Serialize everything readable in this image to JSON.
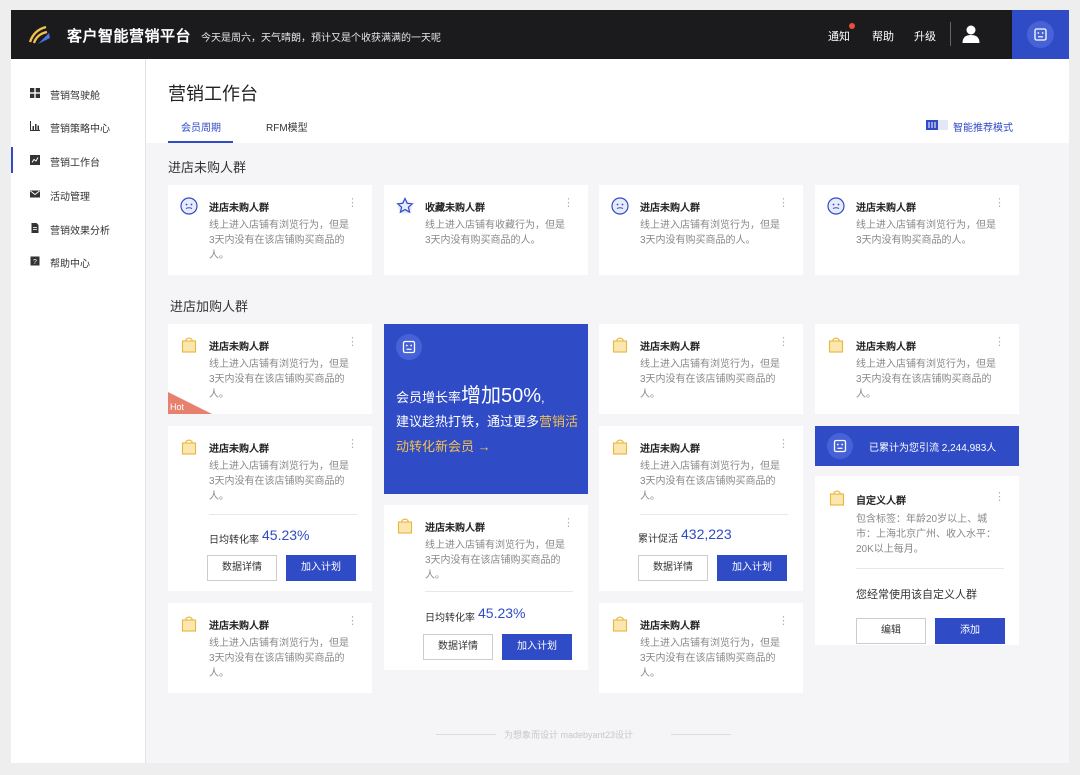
{
  "header": {
    "brand": "客户智能营销平台",
    "greeting": "今天是周六，天气晴朗，预计又是个收获满满的一天呢",
    "nav": {
      "notify": "通知",
      "help": "帮助",
      "upgrade": "升级"
    }
  },
  "sidebar": {
    "items": [
      {
        "label": "营销驾驶舱",
        "icon": "grid-icon"
      },
      {
        "label": "营销策略中心",
        "icon": "bar-chart-icon"
      },
      {
        "label": "营销工作台",
        "icon": "workbench-icon",
        "active": true
      },
      {
        "label": "活动管理",
        "icon": "mail-icon"
      },
      {
        "label": "营销效果分析",
        "icon": "document-icon"
      },
      {
        "label": "帮助中心",
        "icon": "help-icon"
      }
    ]
  },
  "page": {
    "title": "营销工作台",
    "tabs": [
      "会员周期",
      "RFM模型"
    ],
    "smart_mode": "智能推荐模式"
  },
  "section1": {
    "title": "进店未购人群",
    "cards": [
      {
        "title": "进店未购人群",
        "desc": "线上进入店铺有浏览行为，但是3天内没有在该店铺购买商品的人。"
      },
      {
        "title": "收藏未购人群",
        "desc": "线上进入店铺有收藏行为，但是3天内没有购买商品的人。"
      },
      {
        "title": "进店未购人群",
        "desc": "线上进入店铺有浏览行为，但是3天内没有购买商品的人。"
      },
      {
        "title": "进店未购人群",
        "desc": "线上进入店铺有浏览行为，但是3天内没有购买商品的人。"
      }
    ]
  },
  "section2": {
    "title": "进店加购人群",
    "card_a": {
      "title": "进店未购人群",
      "desc": "线上进入店铺有浏览行为，但是3天内没有在该店铺购买商品的人。",
      "badge": "Hot"
    },
    "card_b": {
      "title": "进店未购人群",
      "desc": "线上进入店铺有浏览行为，但是3天内没有在该店铺购买商品的人。",
      "stat_label": "日均转化率",
      "stat_value": "45.23%",
      "btn_detail": "数据详情",
      "btn_add": "加入计划"
    },
    "card_c": {
      "title": "进店未购人群",
      "desc": "线上进入店铺有浏览行为，但是3天内没有在该店铺购买商品的人。"
    },
    "promo": {
      "prefix": "会员增长率",
      "big": "增加50%",
      "suffix": ",",
      "line2a": "建议趁热打铁，通过更多",
      "line2b": "营销活动转化新会员 →"
    },
    "card_d": {
      "title": "进店未购人群",
      "desc": "线上进入店铺有浏览行为，但是3天内没有在该店铺购买商品的人。",
      "stat_label": "日均转化率",
      "stat_value": "45.23%",
      "btn_detail": "数据详情",
      "btn_add": "加入计划"
    },
    "card_e": {
      "title": "进店未购人群",
      "desc": "线上进入店铺有浏览行为，但是3天内没有在该店铺购买商品的人。"
    },
    "card_f": {
      "title": "进店未购人群",
      "desc": "线上进入店铺有浏览行为，但是3天内没有在该店铺购买商品的人。",
      "stat_label": "累计促活",
      "stat_value": "432,223",
      "btn_detail": "数据详情",
      "btn_add": "加入计划"
    },
    "card_g": {
      "title": "进店未购人群",
      "desc": "线上进入店铺有浏览行为，但是3天内没有在该店铺购买商品的人。"
    },
    "card_h": {
      "title": "进店未购人群",
      "desc": "线上进入店铺有浏览行为，但是3天内没有在该店铺购买商品的人。"
    },
    "traffic": "已累计为您引流 2,244,983人",
    "custom": {
      "title": "自定义人群",
      "desc": "包含标签：年龄20岁以上、城市：上海北京广州、收入水平：20K以上每月。",
      "note": "您经常使用该自定义人群",
      "btn_edit": "编辑",
      "btn_add": "添加"
    }
  },
  "footer": "为想象而设计  madebyant23设计",
  "colors": {
    "accent": "#2f4bc6",
    "topbar": "#1b1b1d",
    "hot": "#e8806e",
    "highlight": "#f2c14e"
  }
}
